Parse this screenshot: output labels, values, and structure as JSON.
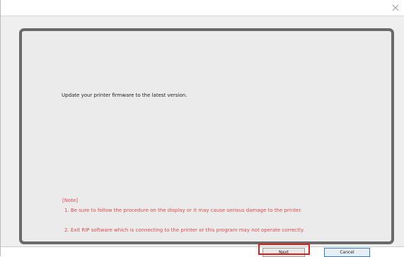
{
  "dialog": {
    "message": "Update your printer firmware to the latest version."
  },
  "note": {
    "title": "[Note]",
    "items": [
      "1.  Be sure to follow the procedure on the display or it may cause serious damage to the printer.",
      "2.  Exit RIP software which is connecting to the printer or this program may not operate correctly."
    ]
  },
  "buttons": {
    "next": "Next",
    "cancel": "Cancel"
  },
  "colors": {
    "note_text": "#e24c4c",
    "highlight_border": "#d8211e"
  },
  "icons": {
    "close": "close-icon"
  }
}
